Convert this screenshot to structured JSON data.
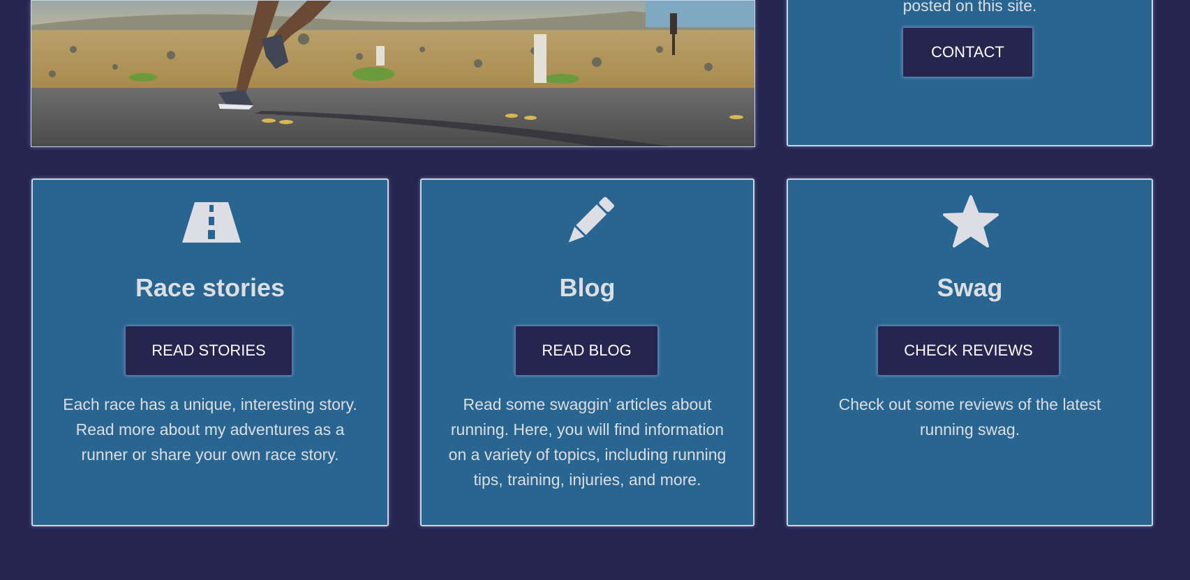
{
  "contact_card": {
    "partial_text": "posted on this site.",
    "button_label": "CONTACT"
  },
  "cards": [
    {
      "icon": "road-icon",
      "title": "Race stories",
      "button_label": "READ STORIES",
      "description": "Each race has a unique, interesting story. Read more about my adventures as a runner or share your own race story."
    },
    {
      "icon": "pencil-icon",
      "title": "Blog",
      "button_label": "READ BLOG",
      "description": "Read some swaggin' articles about running. Here, you will find information on a variety of topics, including running tips, training, injuries, and more."
    },
    {
      "icon": "star-icon",
      "title": "Swag",
      "button_label": "CHECK REVIEWS",
      "description": "Check out some reviews of the latest running swag."
    }
  ],
  "colors": {
    "background": "#26254f",
    "card": "#286590",
    "button": "#26254f",
    "text": "#dcdee4"
  }
}
